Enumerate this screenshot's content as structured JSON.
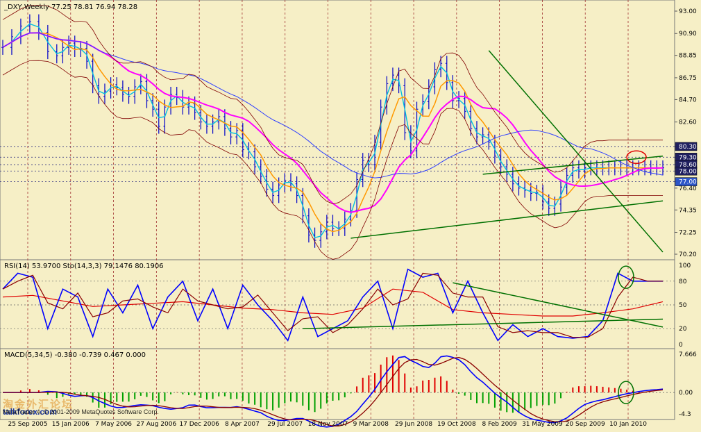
{
  "header": {
    "main_title": "_DXY,Weekly  77.25 78.81 76.94 78.28",
    "rsi_title": "RSI(14) 53.9700  Sto(14,3,3) 79.1476 80.1906",
    "macd_title": "MACD(5,34,5) -0.380 -0.739 0.467 0.000"
  },
  "watermark": {
    "cn_text": "淘金外汇论坛",
    "site": "talkforex.com",
    "copyright": "MetaTrader 4, © 2001-2009 MetaQuotes Software Corp."
  },
  "colors": {
    "background": "#f6efc6",
    "price_bars": "#0000c8",
    "ema_fast": "#00c0e0",
    "ema_mid": "#ff9900",
    "ma_slow": "#ff00ff",
    "ma_long": "#3040ff",
    "bollinger": "#800000",
    "trendline": "#007000",
    "rsi": "#e00000",
    "stoch_main": "#0000ff",
    "stoch_signal": "#8b0000",
    "macd_pos": "#e00000",
    "macd_neg": "#00a000",
    "highlight_circle_price": "#e00000",
    "highlight_circle_osc": "#007000"
  },
  "chart_data": [
    {
      "type": "candlestick",
      "title": "_DXY,Weekly",
      "ohlc_last": {
        "open": 77.25,
        "high": 78.81,
        "low": 76.94,
        "close": 78.28
      },
      "y_ticks": [
        "93.00",
        "90.90",
        "88.85",
        "86.75",
        "84.70",
        "82.60",
        "80.30",
        "79.30",
        "78.60",
        "78.00",
        "77.00",
        "76.40",
        "74.35",
        "72.25",
        "70.20"
      ],
      "ylim": [
        70.2,
        93.0
      ],
      "price_tags": [
        "80.30",
        "79.30",
        "78.60",
        "78.00",
        "77.00"
      ],
      "x_labels": [
        "25 Sep 2005",
        "15 Jan 2006",
        "7 May 2006",
        "27 Aug 2006",
        "17 Dec 2006",
        "8 Apr 2007",
        "29 Jul 2007",
        "18 Nov 2007",
        "9 Mar 2008",
        "29 Jun 2008",
        "19 Oct 2008",
        "8 Feb 2009",
        "31 May 2009",
        "20 Sep 2009",
        "10 Jan 2010"
      ],
      "series": [
        {
          "name": "close",
          "x": [
            0,
            3,
            6,
            9,
            12,
            15,
            18,
            20,
            22,
            24,
            26,
            28,
            30,
            32,
            34,
            36,
            38,
            40,
            42,
            44,
            46,
            48,
            50,
            52,
            54,
            56,
            58,
            60,
            62,
            64,
            66,
            68,
            70,
            72,
            74,
            76,
            78,
            80,
            82,
            84,
            86,
            88,
            90,
            92,
            94,
            96,
            98,
            100,
            102,
            104,
            106,
            108,
            110,
            112,
            114,
            116,
            118,
            120,
            122,
            124,
            126,
            128,
            130,
            132,
            134,
            136,
            138,
            140,
            142,
            144,
            146,
            148,
            150,
            152,
            154,
            156,
            158,
            160,
            162,
            164,
            166,
            168,
            170,
            172,
            174,
            176,
            178,
            180,
            182,
            184,
            186,
            188,
            190,
            192,
            194,
            196,
            198,
            200,
            202,
            204,
            206,
            208,
            210,
            212,
            214,
            216,
            218,
            220
          ],
          "y": [
            89.6,
            90.6,
            91.6,
            92.0,
            91.0,
            89.2,
            88.8,
            89.6,
            90.0,
            89.4,
            89.5,
            88.3,
            86.0,
            85.0,
            85.5,
            86.1,
            85.8,
            85.2,
            85.0,
            85.9,
            86.4,
            84.6,
            83.8,
            82.2,
            84.0,
            85.2,
            84.9,
            84.0,
            84.3,
            83.5,
            82.6,
            82.2,
            82.6,
            83.1,
            82.0,
            81.2,
            81.8,
            80.0,
            79.8,
            78.4,
            77.5,
            76.3,
            75.7,
            76.7,
            77.1,
            76.8,
            75.7,
            73.8,
            72.0,
            71.5,
            72.3,
            73.2,
            72.6,
            72.6,
            73.5,
            74.3,
            77.2,
            79.0,
            78.6,
            80.7,
            84.0,
            86.2,
            87.0,
            86.0,
            81.6,
            79.9,
            83.8,
            84.5,
            85.9,
            87.5,
            88.1,
            86.3,
            84.6,
            84.8,
            83.6,
            82.0,
            81.2,
            81.4,
            80.7,
            79.4,
            78.4,
            77.7,
            76.8,
            76.4,
            76.2,
            75.9,
            76.0,
            75.1,
            74.5,
            74.9,
            76.5,
            77.6,
            78.3,
            78.0,
            78.3,
            78.3,
            78.3,
            78.3,
            78.3,
            78.3,
            78.3,
            78.3,
            78.3,
            78.3,
            78.3,
            78.3,
            78.3,
            78.3
          ]
        },
        {
          "name": "trendline_support",
          "x": [
            116,
            220
          ],
          "y": [
            71.7,
            75.2
          ]
        },
        {
          "name": "trendline_resistance",
          "x": [
            162,
            220
          ],
          "y": [
            89.3,
            70.4
          ]
        },
        {
          "name": "trendline_mid",
          "x": [
            160,
            220
          ],
          "y": [
            77.7,
            79.4
          ]
        }
      ]
    },
    {
      "type": "line",
      "title": "RSI(14) / Sto(14,3,3)",
      "y_ticks": [
        "100",
        "80",
        "50",
        "20",
        "0"
      ],
      "ylim": [
        0,
        100
      ],
      "series": [
        {
          "name": "RSI",
          "x": [
            0,
            10,
            20,
            30,
            40,
            50,
            60,
            70,
            80,
            90,
            100,
            110,
            120,
            130,
            140,
            150,
            160,
            170,
            180,
            190,
            200,
            210,
            220
          ],
          "y": [
            60,
            62,
            55,
            48,
            50,
            52,
            54,
            50,
            46,
            44,
            40,
            38,
            46,
            70,
            66,
            44,
            40,
            38,
            36,
            36,
            40,
            45,
            54
          ]
        },
        {
          "name": "Sto main",
          "x": [
            0,
            5,
            10,
            15,
            20,
            25,
            30,
            35,
            40,
            45,
            50,
            55,
            60,
            65,
            70,
            75,
            80,
            85,
            90,
            95,
            100,
            105,
            110,
            115,
            120,
            125,
            130,
            135,
            140,
            145,
            150,
            155,
            160,
            165,
            170,
            175,
            180,
            185,
            190,
            195,
            200,
            205,
            210,
            215,
            220
          ],
          "y": [
            70,
            90,
            85,
            20,
            70,
            60,
            10,
            70,
            40,
            75,
            20,
            60,
            80,
            30,
            70,
            20,
            75,
            50,
            30,
            5,
            60,
            10,
            20,
            30,
            60,
            80,
            20,
            95,
            85,
            90,
            40,
            80,
            40,
            5,
            25,
            10,
            20,
            10,
            8,
            10,
            30,
            90,
            80,
            80,
            80
          ]
        }
      ]
    },
    {
      "type": "bar",
      "title": "MACD(5,34,5)",
      "y_ticks": [
        "7.666",
        "0.00",
        "-4.3"
      ],
      "ylim": [
        -4.3,
        7.666
      ],
      "values": [
        -0.38,
        -0.739,
        0.467,
        0.0
      ]
    }
  ]
}
